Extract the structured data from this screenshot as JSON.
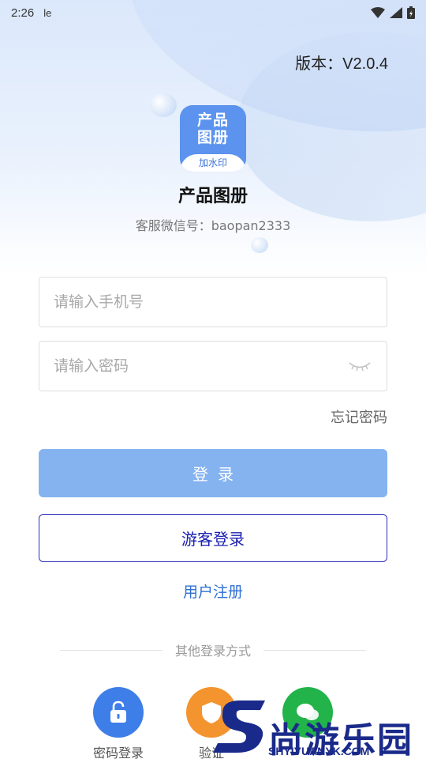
{
  "status_bar": {
    "time": "2:26",
    "carrier_icon": "le"
  },
  "header": {
    "version": "版本：V2.0.4"
  },
  "logo": {
    "line1": "产品",
    "line2": "图册",
    "tag": "加水印"
  },
  "app": {
    "name": "产品图册",
    "service": "客服微信号：baopan2333"
  },
  "form": {
    "phone_placeholder": "请输入手机号",
    "password_placeholder": "请输入密码",
    "forgot": "忘记密码",
    "login": "登录",
    "guest": "游客登录",
    "register": "用户注册"
  },
  "other": {
    "divider": "其他登录方式",
    "methods": [
      {
        "label": "密码登录",
        "icon": "lock-icon",
        "color": "#3e7ee8"
      },
      {
        "label": "验证",
        "icon": "shield-icon",
        "color": "#f3942f"
      },
      {
        "label": "",
        "icon": "wechat-icon",
        "color": "#22b34a"
      }
    ]
  },
  "watermark": {
    "text": "尚游乐园",
    "sub": "SHYIYUANYK.COM"
  },
  "colors": {
    "primary": "#85b3f0",
    "accent": "#1a1fb0",
    "link": "#2e6fd6"
  }
}
